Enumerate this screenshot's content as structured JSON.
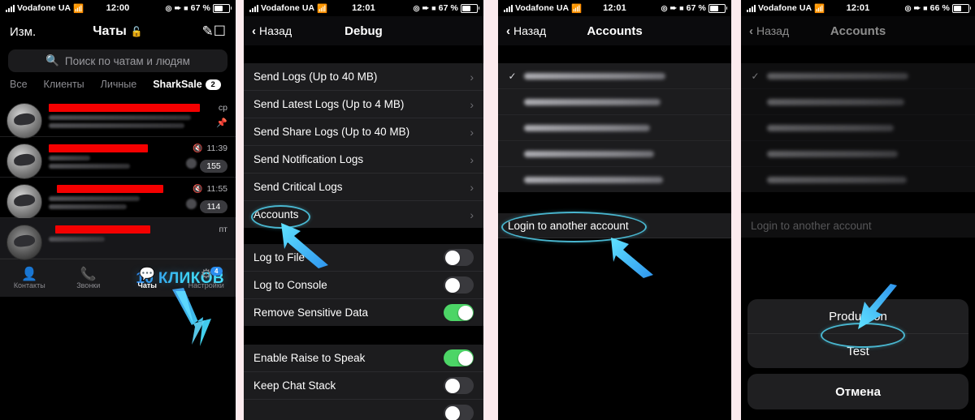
{
  "statusbar": {
    "carrier": "Vodafone UA",
    "time_p1": "12:00",
    "time_p2": "12:01",
    "time_p3": "12:01",
    "time_p4": "12:01",
    "battery_p1": "67 %",
    "battery_p2": "67 %",
    "battery_p3": "67 %",
    "battery_p4": "66 %",
    "icons": [
      "signal-bars-icon",
      "wifi-icon",
      "do-not-disturb-icon",
      "location-arrow-icon",
      "alarm-icon",
      "battery-icon"
    ]
  },
  "panel1": {
    "nav": {
      "left": "Изм.",
      "title": "Чаты",
      "lock_icon": "unlocked-padlock-icon",
      "compose_icon": "compose-icon"
    },
    "search": {
      "placeholder": "Поиск по чатам и людям",
      "icon": "search-icon"
    },
    "segments": [
      {
        "label": "Все",
        "active": false,
        "badge": ""
      },
      {
        "label": "Клиенты",
        "active": false,
        "badge": ""
      },
      {
        "label": "Личные",
        "active": false,
        "badge": ""
      },
      {
        "label": "SharkSale",
        "active": true,
        "badge": "2"
      }
    ],
    "chats": [
      {
        "time": "ср",
        "unread": "",
        "muted": false,
        "pinned": true,
        "selected": false
      },
      {
        "time": "11:39",
        "unread": "155",
        "muted": true,
        "pinned": false,
        "selected": false
      },
      {
        "time": "11:55",
        "unread": "114",
        "muted": true,
        "pinned": false,
        "selected": false
      },
      {
        "time": "пт",
        "unread": "",
        "muted": false,
        "pinned": false,
        "selected": true
      }
    ],
    "annotation": {
      "text": "10 КЛИКОВ",
      "color": "#41d1f5",
      "arrow": "down-right-arrow"
    },
    "tabs": [
      {
        "label": "Контакты",
        "icon": "contacts-icon",
        "active": false,
        "badge": ""
      },
      {
        "label": "Звонки",
        "icon": "phone-icon",
        "active": false,
        "badge": ""
      },
      {
        "label": "Чаты",
        "icon": "chats-icon",
        "active": true,
        "badge": ""
      },
      {
        "label": "Настройки",
        "icon": "settings-icon",
        "active": false,
        "badge": "4"
      }
    ]
  },
  "panel2": {
    "nav": {
      "back": "Назад",
      "title": "Debug"
    },
    "rows": [
      {
        "label": "Send Logs (Up to 40 MB)",
        "type": "disclosure"
      },
      {
        "label": "Send Latest Logs (Up to 4 MB)",
        "type": "disclosure"
      },
      {
        "label": "Send Share Logs (Up to 40 MB)",
        "type": "disclosure"
      },
      {
        "label": "Send Notification Logs",
        "type": "disclosure"
      },
      {
        "label": "Send Critical Logs",
        "type": "disclosure"
      },
      {
        "label": "Accounts",
        "type": "disclosure",
        "highlighted": true
      }
    ],
    "toggles_group1": [
      {
        "label": "Log to File",
        "on": false
      },
      {
        "label": "Log to Console",
        "on": false
      },
      {
        "label": "Remove Sensitive Data",
        "on": true
      }
    ],
    "toggles_group2": [
      {
        "label": "Enable Raise to Speak",
        "on": true
      },
      {
        "label": "Keep Chat Stack",
        "on": false
      }
    ],
    "annotation": {
      "target": "Accounts",
      "arrow": "up-right-arrow",
      "color": "#49b6cf"
    }
  },
  "panel3": {
    "nav": {
      "back": "Назад",
      "title": "Accounts"
    },
    "accounts": [
      {
        "checked": true,
        "redacted": true
      },
      {
        "checked": false,
        "redacted": true
      },
      {
        "checked": false,
        "redacted": true
      },
      {
        "checked": false,
        "redacted": true
      },
      {
        "checked": false,
        "redacted": true
      }
    ],
    "login_row": "Login to another account",
    "annotation": {
      "target": "Login to another account",
      "arrow": "up-right-arrow",
      "color": "#49b6cf"
    }
  },
  "panel4": {
    "nav": {
      "back": "Назад",
      "title": "Accounts"
    },
    "accounts": [
      {
        "checked": true,
        "redacted": true
      },
      {
        "checked": false,
        "redacted": true
      },
      {
        "checked": false,
        "redacted": true
      },
      {
        "checked": false,
        "redacted": true
      },
      {
        "checked": false,
        "redacted": true
      }
    ],
    "login_row": "Login to another account",
    "action_sheet": {
      "options": [
        "Production",
        "Test"
      ],
      "cancel": "Отмена",
      "highlighted": "Production"
    },
    "annotation": {
      "target": "Production",
      "arrow": "down-left-arrow",
      "color": "#49b6cf"
    }
  }
}
